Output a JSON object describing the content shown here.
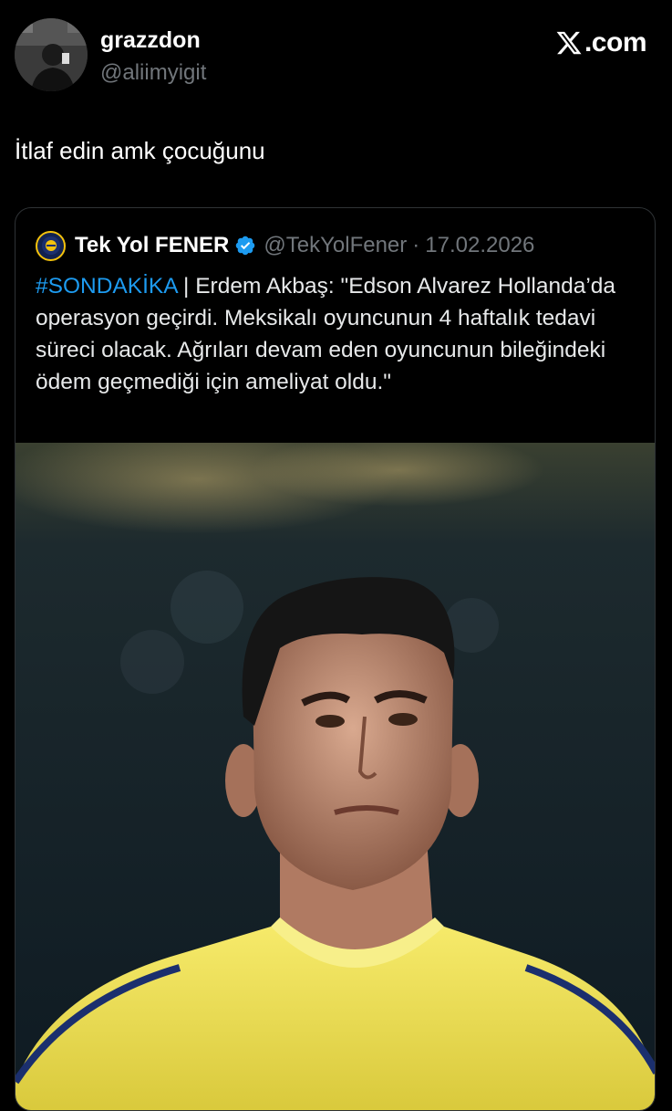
{
  "author": {
    "display_name": "grazzdon",
    "handle": "@aliimyigit",
    "avatar_icon": "profile-photo"
  },
  "brand": {
    "logo_icon": "x-logo-icon",
    "text": ".com"
  },
  "tweet": {
    "text": "İtlaf edin amk çocuğunu"
  },
  "quoted": {
    "display_name": "Tek Yol FENER",
    "verified_icon": "verified-badge-icon",
    "handle": "@TekYolFener",
    "separator": "·",
    "date": "17.02.2026",
    "hashtag": "#SONDAKİKA",
    "body": " | Erdem Akbaş: \"Edson Alvarez Hollanda’da operasyon geçirdi. Meksikalı oyuncunun 4 haftalık tedavi süreci olacak. Ağrıları devam eden oyuncunun bileğindeki ödem geçmediği için ameliyat oldu.\"",
    "image_icon": "player-photo"
  },
  "colors": {
    "background": "#000000",
    "hashtag": "#1d9bf0",
    "muted": "#71767b",
    "verified": "#1d9bf0",
    "jersey": "#f0e14a"
  }
}
